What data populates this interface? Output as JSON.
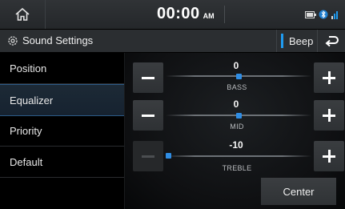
{
  "status_bar": {
    "home_icon": "home-icon",
    "time": "00:00",
    "ampm": "AM",
    "icons": [
      "battery-icon",
      "bluetooth-icon",
      "signal-icon"
    ]
  },
  "title_bar": {
    "icon": "gear-icon",
    "title": "Sound Settings",
    "beep_label": "Beep",
    "back_icon": "back-arrow-icon"
  },
  "menu": {
    "items": [
      {
        "label": "Position",
        "selected": false
      },
      {
        "label": "Equalizer",
        "selected": true
      },
      {
        "label": "Priority",
        "selected": false
      },
      {
        "label": "Default",
        "selected": false
      }
    ]
  },
  "equalizer": {
    "bands": [
      {
        "label": "BASS",
        "value": "0",
        "level": 0
      },
      {
        "label": "MID",
        "value": "0",
        "level": 0
      },
      {
        "label": "TREBLE",
        "value": "-10",
        "level": -10
      }
    ],
    "range": [
      -10,
      10
    ],
    "minus_icon": "minus-icon",
    "plus_icon": "plus-icon"
  },
  "center_label": "Center",
  "colors": {
    "accent": "#1f9bf0",
    "thumb": "#2f8de4",
    "selected_border": "#2c5a86"
  }
}
